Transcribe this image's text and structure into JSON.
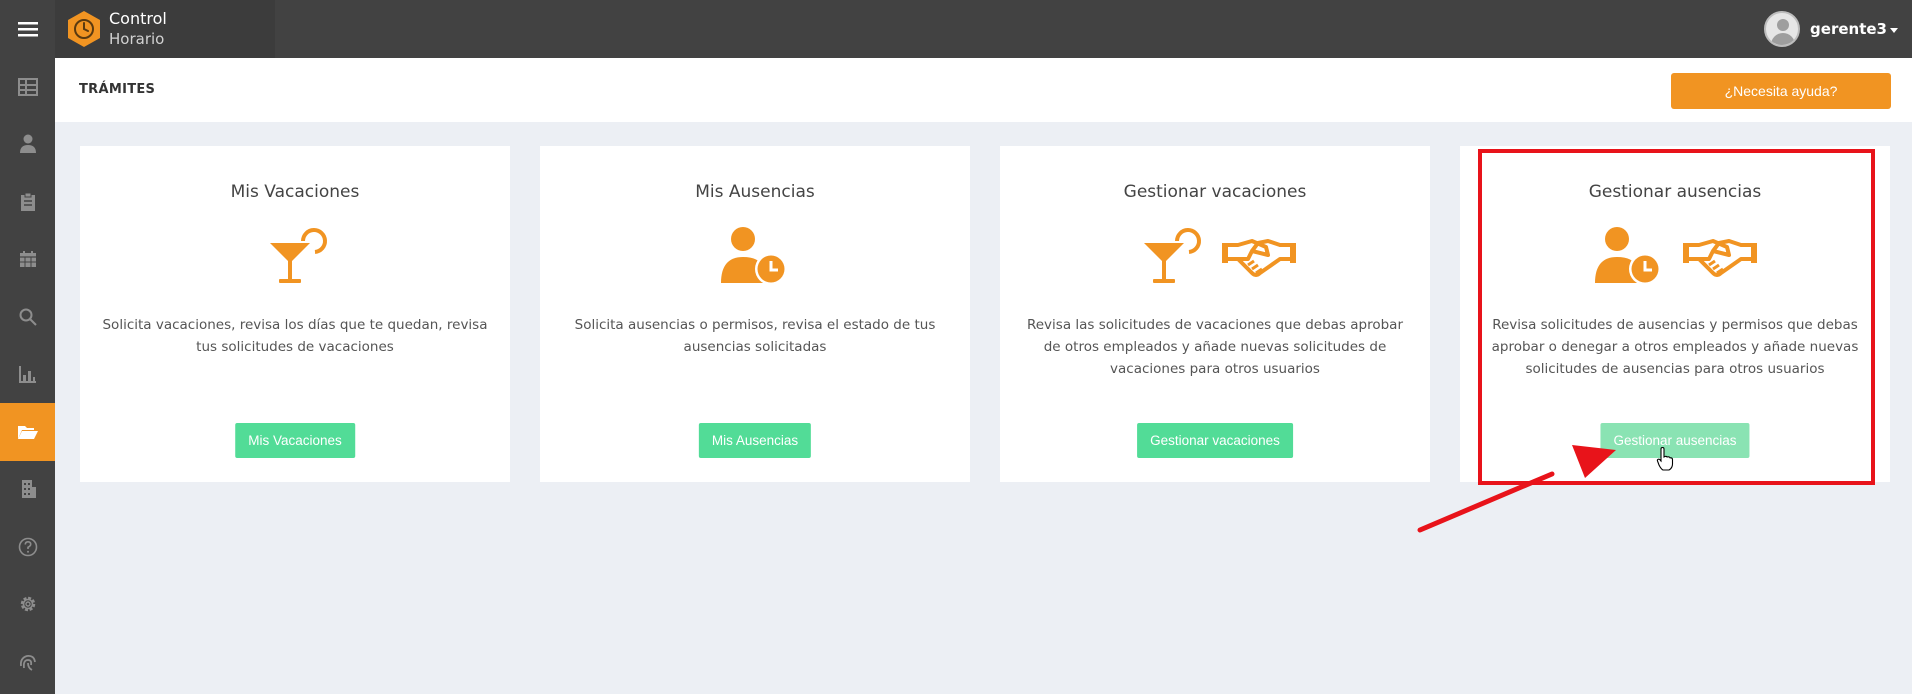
{
  "app": {
    "brand_line1": "Control",
    "brand_line2": "Horario",
    "brand_color": "#f19422"
  },
  "user": {
    "name": "gerente3"
  },
  "sidebar": {
    "items": [
      {
        "icon": "dashboard-grid-icon",
        "active": false
      },
      {
        "icon": "user-icon",
        "active": false
      },
      {
        "icon": "clipboard-icon",
        "active": false
      },
      {
        "icon": "calendar-icon",
        "active": false
      },
      {
        "icon": "search-icon",
        "active": false
      },
      {
        "icon": "report-chart-icon",
        "active": false
      },
      {
        "icon": "folder-open-icon",
        "active": true
      },
      {
        "icon": "building-icon",
        "active": false
      },
      {
        "icon": "help-circle-icon",
        "active": false
      },
      {
        "icon": "gear-icon",
        "active": false
      },
      {
        "icon": "fingerprint-icon",
        "active": false
      }
    ]
  },
  "header": {
    "title": "TRÁMITES",
    "help_button": "¿Necesita ayuda?"
  },
  "cards": [
    {
      "title": "Mis Vacaciones",
      "description": "Solicita vacaciones, revisa los días que te quedan, revisa tus solicitudes de vacaciones",
      "button": "Mis Vacaciones",
      "icons": [
        "cocktail-icon"
      ]
    },
    {
      "title": "Mis Ausencias",
      "description": "Solicita ausencias o permisos, revisa el estado de tus ausencias solicitadas",
      "button": "Mis Ausencias",
      "icons": [
        "user-clock-icon"
      ]
    },
    {
      "title": "Gestionar vacaciones",
      "description": "Revisa las solicitudes de vacaciones que debas aprobar de otros empleados y añade nuevas solicitudes de vacaciones para otros usuarios",
      "button": "Gestionar vacaciones",
      "icons": [
        "cocktail-icon",
        "handshake-icon"
      ]
    },
    {
      "title": "Gestionar ausencias",
      "description": "Revisa solicitudes de ausencias y permisos que debas aprobar o denegar a otros empleados y añade nuevas solicitudes de ausencias para otros usuarios",
      "button": "Gestionar ausencias",
      "icons": [
        "user-clock-icon",
        "handshake-icon"
      ]
    }
  ],
  "colors": {
    "accent": "#f19422",
    "button_green": "#52dc97",
    "annotation_red": "#e8131a",
    "topbar": "#424242"
  }
}
